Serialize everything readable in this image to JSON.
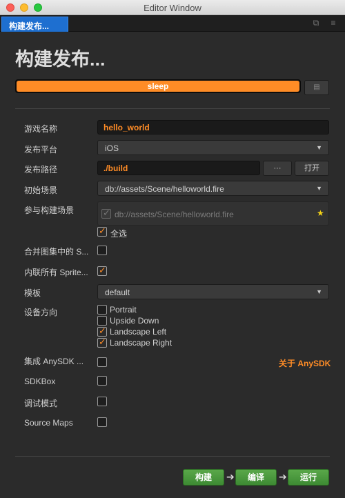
{
  "window": {
    "title": "Editor Window"
  },
  "tabs": [
    {
      "label": "构建发布..."
    }
  ],
  "page_title": "构建发布...",
  "progress": {
    "status_text": "sleep",
    "value": 1.0,
    "color": "#ff8c26"
  },
  "fields": {
    "game_name": {
      "label": "游戏名称",
      "value": "hello_world"
    },
    "platform": {
      "label": "发布平台",
      "value": "iOS"
    },
    "build_path": {
      "label": "发布路径",
      "value": "./build",
      "browse_label": "···",
      "open_label": "打开"
    },
    "start_scene": {
      "label": "初始场景",
      "value": "db://assets/Scene/helloworld.fire"
    },
    "included_scenes": {
      "label": "参与构建场景",
      "items": [
        {
          "path": "db://assets/Scene/helloworld.fire",
          "checked": true
        }
      ],
      "select_all_label": "全选",
      "select_all_checked": true
    },
    "merge_atlas": {
      "label": "合并图集中的 S...",
      "checked": false
    },
    "inline_sprite": {
      "label": "内联所有 Sprite...",
      "checked": true
    },
    "template": {
      "label": "模板",
      "value": "default"
    },
    "orientation": {
      "label": "设备方向",
      "options": [
        {
          "label": "Portrait",
          "checked": false
        },
        {
          "label": "Upside Down",
          "checked": false
        },
        {
          "label": "Landscape Left",
          "checked": true
        },
        {
          "label": "Landscape Right",
          "checked": true
        }
      ]
    },
    "anysdk": {
      "label": "集成 AnySDK ...",
      "checked": false,
      "link": "关于 AnySDK"
    },
    "sdkbox": {
      "label": "SDKBox",
      "checked": false
    },
    "debug": {
      "label": "调试模式",
      "checked": false
    },
    "source_maps": {
      "label": "Source Maps",
      "checked": false
    }
  },
  "actions": {
    "build": "构建",
    "compile": "编译",
    "run": "运行"
  },
  "colors": {
    "accent": "#ff8c26",
    "tab": "#1e6fd0",
    "action_green": "#4a9a3e"
  }
}
